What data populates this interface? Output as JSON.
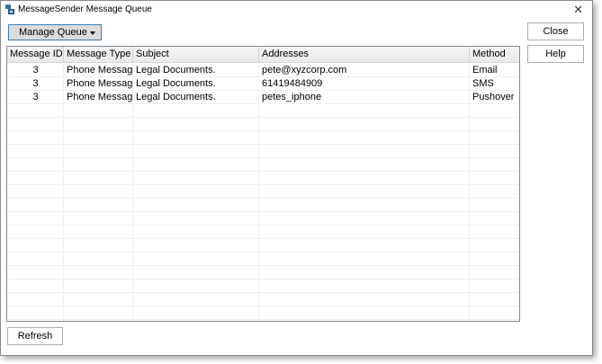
{
  "window": {
    "title": "MessageSender Message Queue",
    "close_glyph": "✕"
  },
  "toolbar": {
    "manage_queue_label": "Manage Queue"
  },
  "table": {
    "columns": [
      "Message ID",
      "Message Type",
      "Subject",
      "Addresses",
      "Method"
    ],
    "rows": [
      [
        "3",
        "Phone Message",
        "Legal Documents.",
        "pete@xyzcorp.com",
        "Email"
      ],
      [
        "3",
        "Phone Message",
        "Legal Documents.",
        "61419484909",
        "SMS"
      ],
      [
        "3",
        "Phone Message",
        "Legal Documents.",
        "petes_iphone",
        "Pushover"
      ]
    ]
  },
  "buttons": {
    "close_label": "Close",
    "help_label": "Help",
    "refresh_label": "Refresh"
  },
  "colors": {
    "accent_border": "#3c7fb1",
    "button_face": "#dcdcdc"
  },
  "icons": {
    "app": "app-icon",
    "dropdown": "chevron-down-icon",
    "close": "close-icon"
  }
}
